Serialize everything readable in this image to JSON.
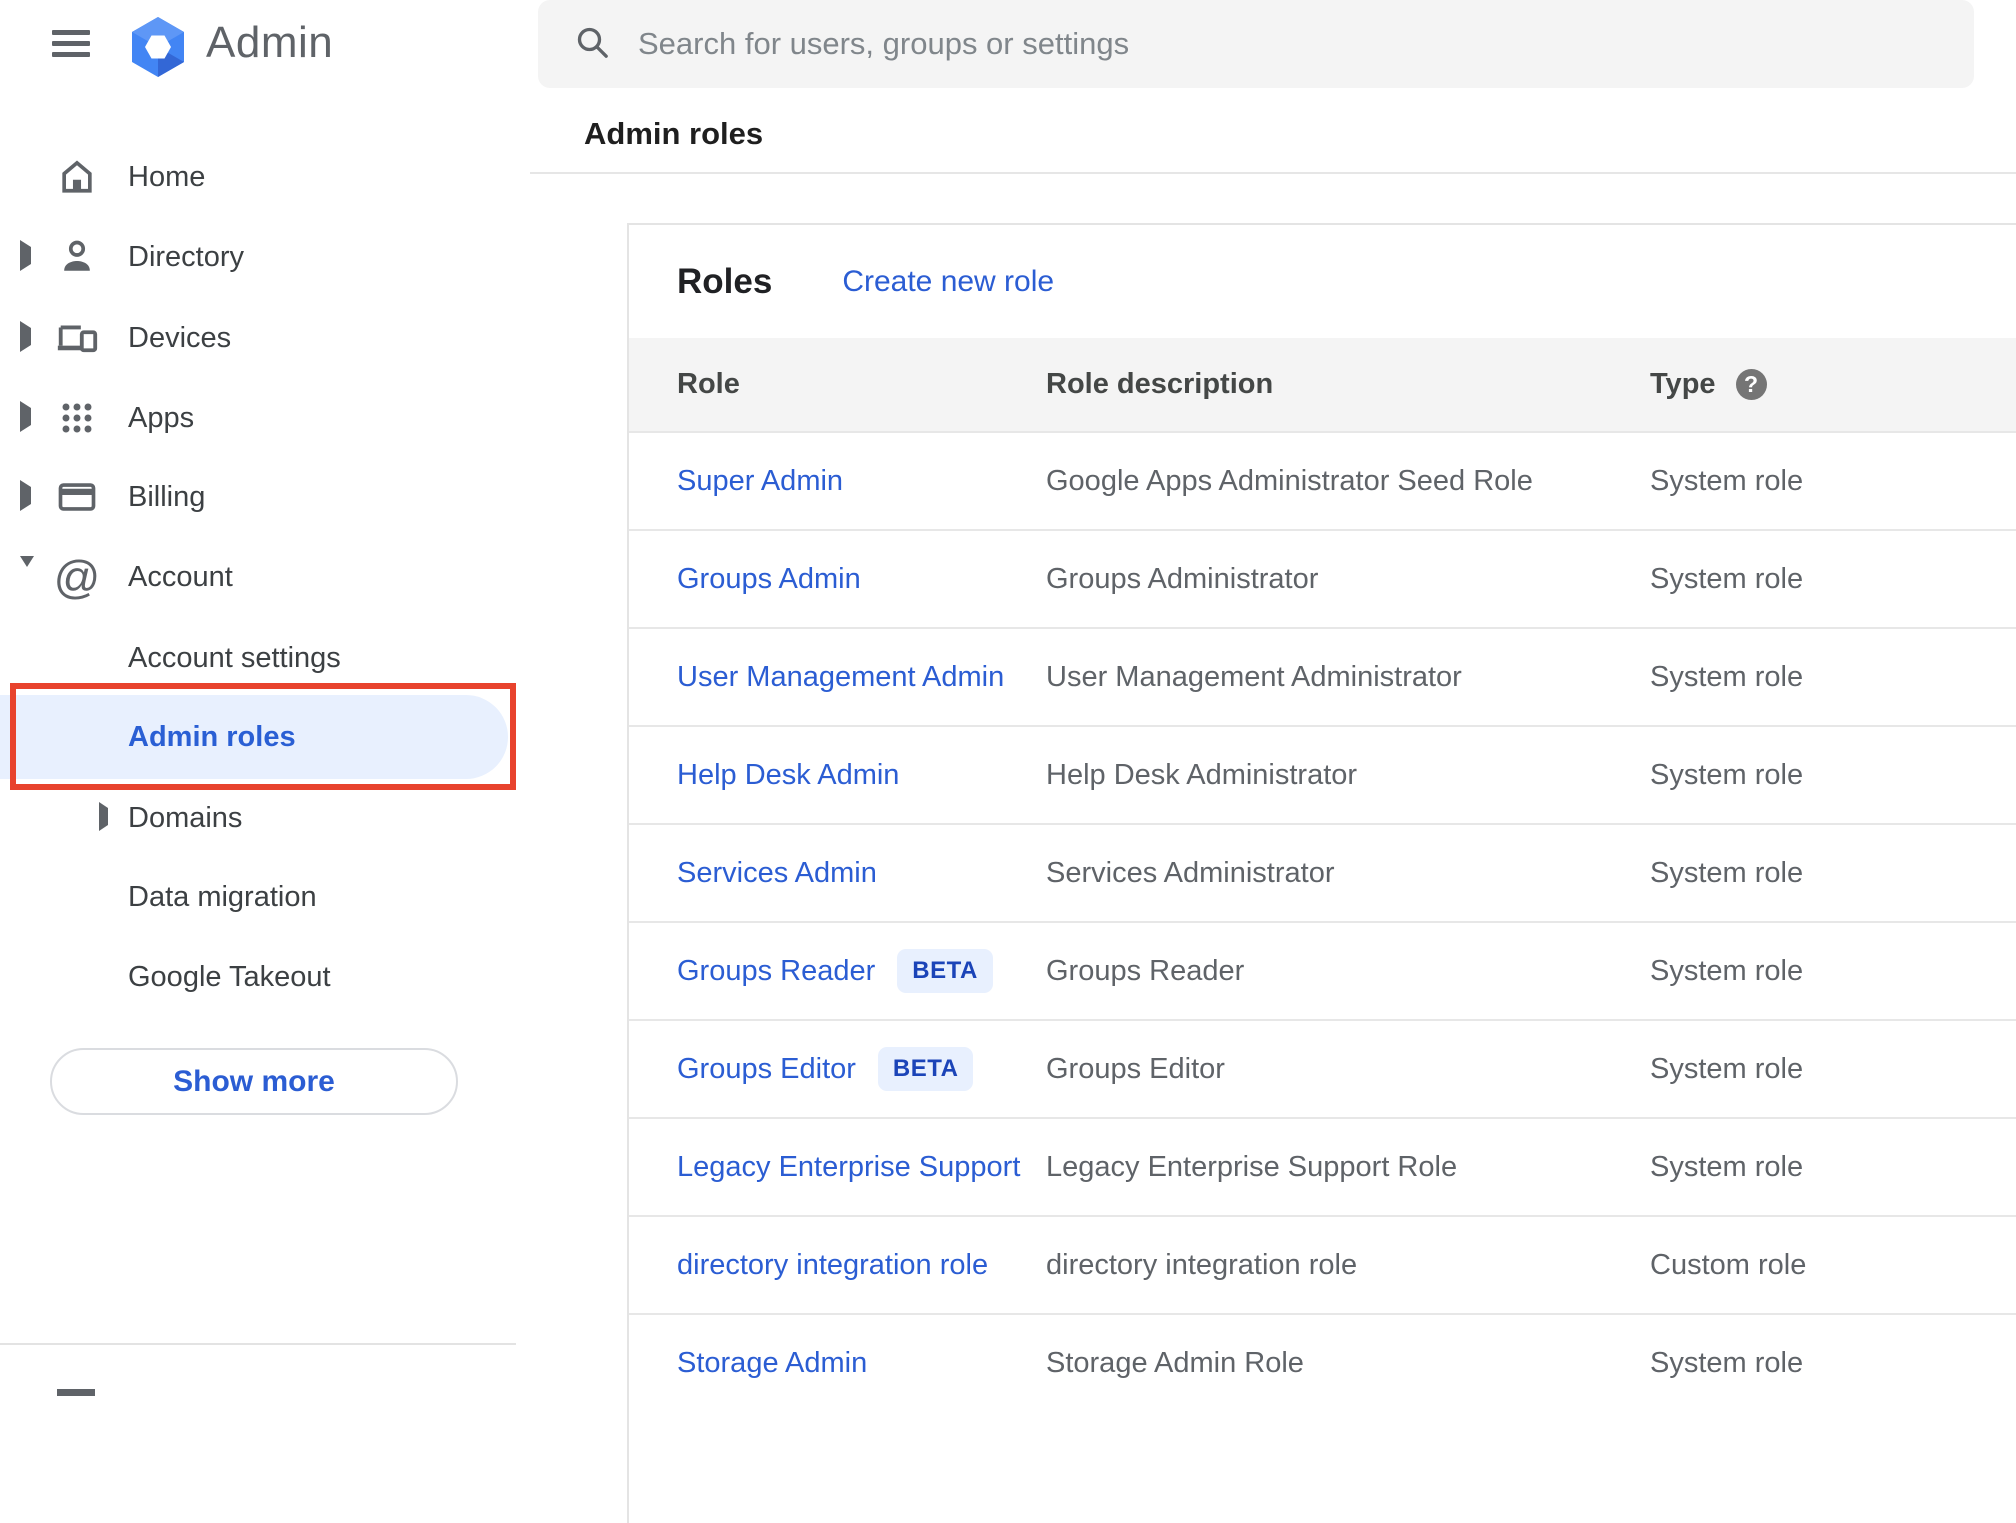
{
  "sidebar": {
    "logo_text": "Admin",
    "items": [
      {
        "label": "Home"
      },
      {
        "label": "Directory"
      },
      {
        "label": "Devices"
      },
      {
        "label": "Apps"
      },
      {
        "label": "Billing"
      },
      {
        "label": "Account"
      }
    ],
    "account_children": [
      {
        "label": "Account settings"
      },
      {
        "label": "Admin roles",
        "selected": true
      },
      {
        "label": "Domains"
      },
      {
        "label": "Data migration"
      },
      {
        "label": "Google Takeout"
      }
    ],
    "show_more_label": "Show more"
  },
  "search": {
    "placeholder": "Search for users, groups or settings"
  },
  "breadcrumb": "Admin roles",
  "roles_card": {
    "title": "Roles",
    "create_link": "Create new role",
    "columns": {
      "role": "Role",
      "description": "Role description",
      "type": "Type"
    },
    "help_icon_glyph": "?",
    "beta_label": "BETA",
    "rows": [
      {
        "role": "Super Admin",
        "beta": false,
        "description": "Google Apps Administrator Seed Role",
        "type": "System role"
      },
      {
        "role": "Groups Admin",
        "beta": false,
        "description": "Groups Administrator",
        "type": "System role"
      },
      {
        "role": "User Management Admin",
        "beta": false,
        "description": "User Management Administrator",
        "type": "System role"
      },
      {
        "role": "Help Desk Admin",
        "beta": false,
        "description": "Help Desk Administrator",
        "type": "System role"
      },
      {
        "role": "Services Admin",
        "beta": false,
        "description": "Services Administrator",
        "type": "System role"
      },
      {
        "role": "Groups Reader",
        "beta": true,
        "description": "Groups Reader",
        "type": "System role"
      },
      {
        "role": "Groups Editor",
        "beta": true,
        "description": "Groups Editor",
        "type": "System role"
      },
      {
        "role": "Legacy Enterprise Support",
        "beta": false,
        "description": "Legacy Enterprise Support Role",
        "type": "System role"
      },
      {
        "role": "directory integration role",
        "beta": false,
        "description": "directory integration role",
        "type": "Custom role"
      },
      {
        "role": "Storage Admin",
        "beta": false,
        "description": "Storage Admin Role",
        "type": "System role"
      }
    ]
  },
  "colors": {
    "link_blue": "#2B5DD3",
    "selected_item_blue": "#2A5FD4",
    "selected_bg": "#E8F0FE",
    "annotation_red": "#E8432D",
    "beta_text": "#1B44B8",
    "header_row_bg": "#F4F4F4",
    "icon_gray": "#5F6368"
  }
}
